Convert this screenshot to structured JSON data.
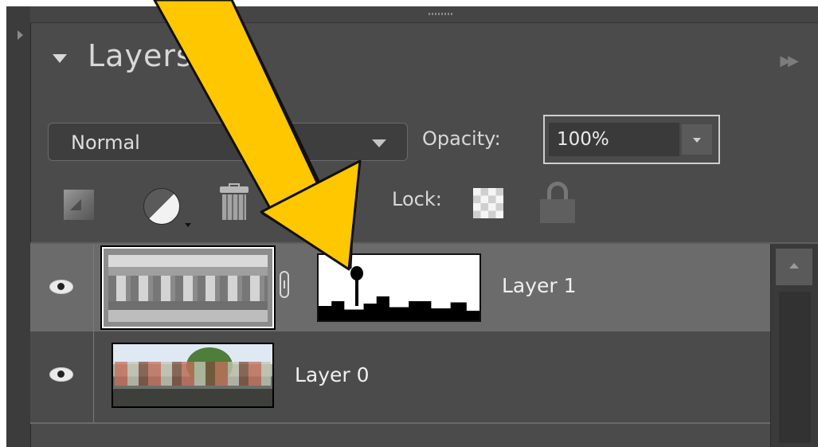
{
  "panel": {
    "title": "Layers",
    "menu_icon": "double-chevron-right-icon"
  },
  "blend_mode": {
    "selected": "Normal"
  },
  "opacity": {
    "label": "Opacity:",
    "value": "100%"
  },
  "tools": {
    "new_layer_icon": "new-layer-icon",
    "adjustment_icon": "adjustment-layer-icon",
    "delete_icon": "trash-icon"
  },
  "lock": {
    "label": "Lock:",
    "transparency_icon": "checkerboard-icon",
    "all_icon": "padlock-icon"
  },
  "layers": [
    {
      "name": "Layer 1",
      "visible": true,
      "selected": true,
      "has_mask": true
    },
    {
      "name": "Layer 0",
      "visible": true,
      "selected": false,
      "has_mask": false
    }
  ],
  "annotation": {
    "arrow_color": "#ffc700"
  }
}
